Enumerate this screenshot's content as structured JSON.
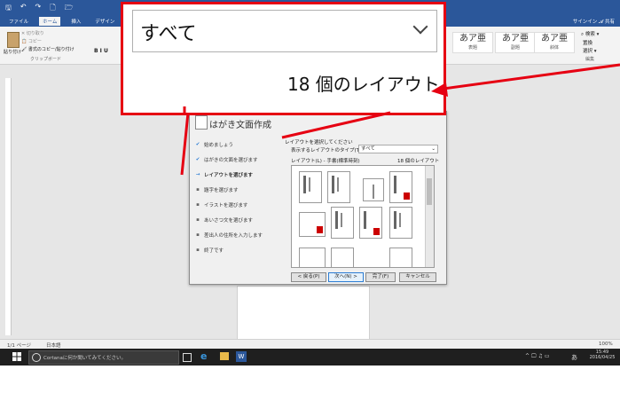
{
  "quick_access": {
    "save": "🖫",
    "undo": "↶",
    "redo": "↷",
    "new": "🗋",
    "open": "🗁"
  },
  "tabs": [
    "ファイル",
    "ホーム",
    "挿入",
    "デザイン"
  ],
  "user": "サインイン  𝓐 共有",
  "ribbon": {
    "paste": "貼り付け",
    "cut": "✕ 切り取り",
    "copy": "📋 コピー",
    "format_painter": "🖌 書式のコピー/貼り付け",
    "clipboard_group": "クリップボード",
    "font_buttons": "B  I  U",
    "styles": [
      {
        "glyph": "あア亜",
        "label": "表題"
      },
      {
        "glyph": "あア亜",
        "label": "副題"
      },
      {
        "glyph": "あア亜",
        "label": "斜体"
      }
    ],
    "find": "⌕ 検索 ▾",
    "replace": "置換",
    "select": "選択 ▾",
    "edit_group": "編集"
  },
  "dialog": {
    "title": "はがき文面作成",
    "steps": [
      {
        "mark": "✔",
        "label": "始めましょう"
      },
      {
        "mark": "✔",
        "label": "はがきの文面を選びます"
      },
      {
        "mark": "→",
        "label": "レイアウトを選びます"
      },
      {
        "mark": "▪",
        "label": "題字を選びます"
      },
      {
        "mark": "▪",
        "label": "イラストを選びます"
      },
      {
        "mark": "▪",
        "label": "あいさつ文を選びます"
      },
      {
        "mark": "▪",
        "label": "差出人の住所を入力します"
      },
      {
        "mark": "▪",
        "label": "終了です"
      }
    ],
    "instruction": "レイアウトを選択してください",
    "type_label": "表示するレイアウトのタイプ(T):",
    "type_value": "すべて",
    "layout_label": "レイアウト(L) - 手書(標準時刻)",
    "layout_count": "18 個のレイアウト",
    "buttons": {
      "back": "< 戻る(P)",
      "next": "次へ(N) >",
      "finish": "完了(F)",
      "cancel": "キャンセル"
    }
  },
  "callout": {
    "select_value": "すべて",
    "count": "18 個のレイアウト"
  },
  "status": {
    "page": "1/1 ページ",
    "lang": "日本語",
    "zoom": "100%"
  },
  "taskbar": {
    "search": "Cortanaに何か聞いてみてください。",
    "time": "15:49",
    "date": "2016/04/25",
    "ime": "あ"
  }
}
